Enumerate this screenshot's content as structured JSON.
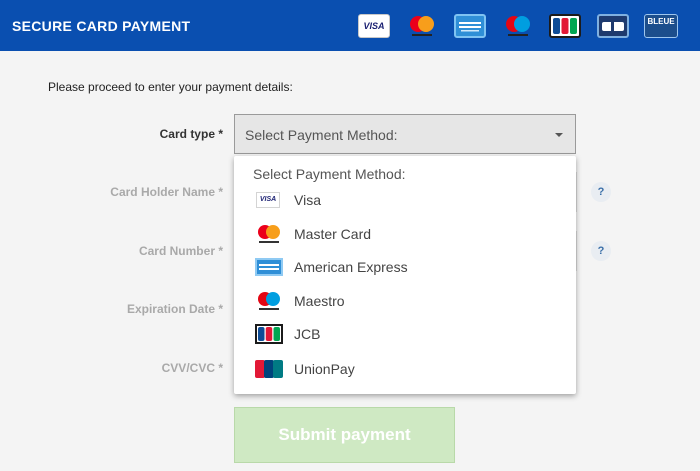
{
  "header": {
    "title": "SECURE CARD PAYMENT",
    "brands": [
      {
        "name": "Visa",
        "icon": "visa-logo",
        "text": "VISA"
      },
      {
        "name": "Mastercard",
        "icon": "mastercard-logo"
      },
      {
        "name": "American Express",
        "icon": "amex-logo"
      },
      {
        "name": "Maestro",
        "icon": "maestro-logo"
      },
      {
        "name": "JCB",
        "icon": "jcb-logo"
      },
      {
        "name": "CB",
        "icon": "cb-logo"
      },
      {
        "name": "Carte Bleue",
        "icon": "carte-bleue-logo",
        "text": "BLEUE"
      }
    ],
    "colors": {
      "bar": "#0a4fb0",
      "text": "#ffffff"
    }
  },
  "form": {
    "intro": "Please proceed to enter your payment details:",
    "card_type_label": "Card type *",
    "card_holder_label": "Card Holder Name *",
    "card_number_label": "Card Number *",
    "expiration_label": "Expiration Date *",
    "cvv_label": "CVV/CVC *",
    "help_glyph": "?",
    "select_value": "Select Payment Method:",
    "submit_label": "Submit payment"
  },
  "dropdown": {
    "header": "Select Payment Method:",
    "options": [
      {
        "label": "Visa",
        "icon": "visa-icon"
      },
      {
        "label": "Master Card",
        "icon": "mastercard-icon"
      },
      {
        "label": "American Express",
        "icon": "amex-icon"
      },
      {
        "label": "Maestro",
        "icon": "maestro-icon"
      },
      {
        "label": "JCB",
        "icon": "jcb-icon"
      },
      {
        "label": "UnionPay",
        "icon": "unionpay-icon"
      }
    ]
  }
}
